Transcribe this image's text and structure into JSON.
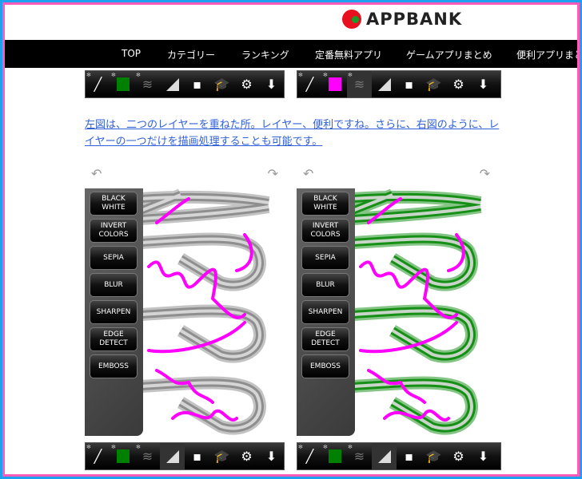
{
  "header": {
    "logo_text": "APPBANK"
  },
  "nav": {
    "items": [
      "TOP",
      "カテゴリー",
      "ランキング",
      "定番無料アプリ",
      "ゲームアプリまとめ",
      "便利アプリまとめ"
    ]
  },
  "toolbar_top_left": {
    "color": "#008000",
    "icons": [
      "gear-icon",
      "brush-icon",
      "color-swatch",
      "layers-icon",
      "shape-icon",
      "save-icon",
      "education-icon",
      "settings-icon",
      "download-icon"
    ]
  },
  "toolbar_top_right": {
    "color": "#ff00ff"
  },
  "toolbar_bottom_left": {
    "color": "#008000"
  },
  "toolbar_bottom_right": {
    "color": "#008000"
  },
  "paragraph": "左図は、二つのレイヤーを重ねた所。レイヤー、便利ですね。さらに、右図のように、レイヤーの一つだけを描画処理することも可能です。",
  "filters": [
    "BLACK\nWHITE",
    "INVERT\nCOLORS",
    "SEPIA",
    "BLUR",
    "SHARPEN",
    "EDGE\nDETECT",
    "EMBOSS"
  ],
  "canvas_left": {
    "stroke_color": "#888888",
    "ink_color": "#ff00ff"
  },
  "canvas_right": {
    "stroke_color": "#0a8a0a",
    "ink_color": "#ff00ff"
  }
}
